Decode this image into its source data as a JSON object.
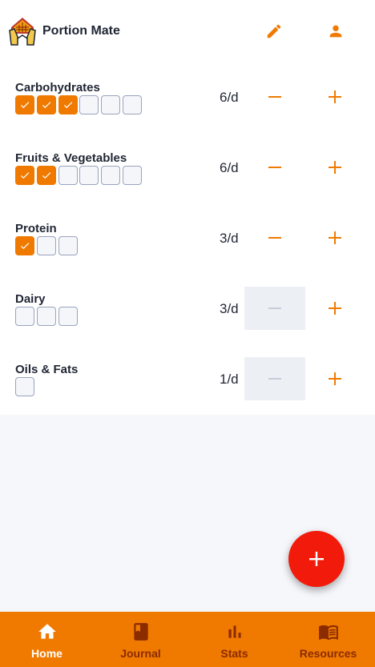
{
  "app": {
    "title": "Portion Mate"
  },
  "header": {
    "edit_icon": "pencil-icon",
    "account_icon": "person-icon"
  },
  "colors": {
    "accent": "#f07a00",
    "fab": "#f21b0b",
    "nav_active": "#ffffff",
    "nav_inactive": "#8a2b00"
  },
  "portions": [
    {
      "label": "Carbohydrates",
      "rate": "6/d",
      "target": 6,
      "checked": 3,
      "minus_enabled": true
    },
    {
      "label": "Fruits & Vegetables",
      "rate": "6/d",
      "target": 6,
      "checked": 2,
      "minus_enabled": true
    },
    {
      "label": "Protein",
      "rate": "3/d",
      "target": 3,
      "checked": 1,
      "minus_enabled": true
    },
    {
      "label": "Dairy",
      "rate": "3/d",
      "target": 3,
      "checked": 0,
      "minus_enabled": false
    },
    {
      "label": "Oils & Fats",
      "rate": "1/d",
      "target": 1,
      "checked": 0,
      "minus_enabled": false
    }
  ],
  "fab": {
    "icon": "plus-icon"
  },
  "nav": [
    {
      "label": "Home",
      "icon": "home-icon",
      "active": true
    },
    {
      "label": "Journal",
      "icon": "book-icon",
      "active": false
    },
    {
      "label": "Stats",
      "icon": "bar-chart-icon",
      "active": false
    },
    {
      "label": "Resources",
      "icon": "open-book-icon",
      "active": false
    }
  ]
}
